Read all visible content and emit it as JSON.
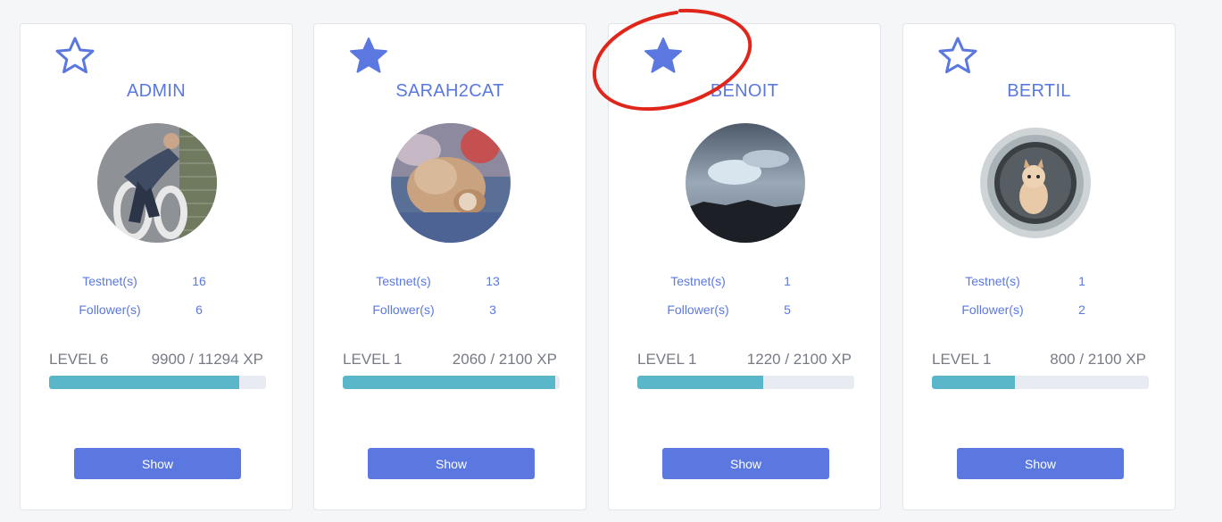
{
  "colors": {
    "accent": "#5a78e0",
    "progress": "#5ab7c9",
    "annotation": "#e0261b"
  },
  "users": [
    {
      "name": "ADMIN",
      "favorite": false,
      "favorite_icon": "star-outline-icon",
      "avatar": "man-lying-on-bike-lane-photo",
      "testnets_label": "Testnet(s)",
      "testnets": "16",
      "followers_label": "Follower(s)",
      "followers": "6",
      "level": "LEVEL 6",
      "xp": "9900 / 11294 XP",
      "progress_fraction": 0.877,
      "button": "Show"
    },
    {
      "name": "SARAH2CAT",
      "favorite": true,
      "favorite_icon": "star-filled-icon",
      "avatar": "cat-on-blanket-photo",
      "testnets_label": "Testnet(s)",
      "testnets": "13",
      "followers_label": "Follower(s)",
      "followers": "3",
      "level": "LEVEL 1",
      "xp": "2060 / 2100 XP",
      "progress_fraction": 0.981,
      "button": "Show"
    },
    {
      "name": "BENOIT",
      "favorite": true,
      "favorite_icon": "star-filled-icon",
      "avatar": "cloudy-sky-photo",
      "testnets_label": "Testnet(s)",
      "testnets": "1",
      "followers_label": "Follower(s)",
      "followers": "5",
      "level": "LEVEL 1",
      "xp": "1220 / 2100 XP",
      "progress_fraction": 0.581,
      "button": "Show"
    },
    {
      "name": "BERTIL",
      "favorite": false,
      "favorite_icon": "star-outline-icon",
      "avatar": "kitten-in-washing-machine-photo",
      "testnets_label": "Testnet(s)",
      "testnets": "1",
      "followers_label": "Follower(s)",
      "followers": "2",
      "level": "LEVEL 1",
      "xp": "800 / 2100 XP",
      "progress_fraction": 0.381,
      "button": "Show"
    }
  ]
}
